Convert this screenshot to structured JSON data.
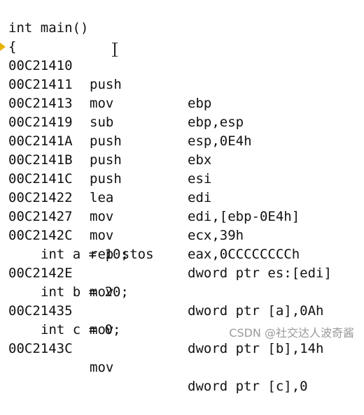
{
  "source": {
    "func_sig": "int main()",
    "open_brace": "{",
    "stmt_a": "int a = 10;",
    "stmt_b": "int b = 20;",
    "stmt_c": "int c = 0;"
  },
  "instructions": [
    {
      "addr": "00C21410",
      "mnem": "push",
      "ops": "ebp"
    },
    {
      "addr": "00C21411",
      "mnem": "mov",
      "ops": "ebp,esp"
    },
    {
      "addr": "00C21413",
      "mnem": "sub",
      "ops": "esp,0E4h"
    },
    {
      "addr": "00C21419",
      "mnem": "push",
      "ops": "ebx"
    },
    {
      "addr": "00C2141A",
      "mnem": "push",
      "ops": "esi"
    },
    {
      "addr": "00C2141B",
      "mnem": "push",
      "ops": "edi"
    },
    {
      "addr": "00C2141C",
      "mnem": "lea",
      "ops": "edi,[ebp-0E4h]"
    },
    {
      "addr": "00C21422",
      "mnem": "mov",
      "ops": "ecx,39h"
    },
    {
      "addr": "00C21427",
      "mnem": "mov",
      "ops": "eax,0CCCCCCCCh"
    },
    {
      "addr": "00C2142C",
      "mnem": "rep stos",
      "ops": "dword ptr es:[edi]"
    },
    {
      "addr": "00C2142E",
      "mnem": "mov",
      "ops": "dword ptr [a],0Ah"
    },
    {
      "addr": "00C21435",
      "mnem": "mov",
      "ops": "dword ptr [b],14h"
    },
    {
      "addr": "00C2143C",
      "mnem": "mov",
      "ops": "dword ptr [c],0"
    }
  ],
  "watermark": "CSDN @社交达人波奇酱",
  "colors": {
    "background": "#ffffff",
    "text": "#111111",
    "breakpoint_marker": "#e8b400"
  },
  "icons": {
    "breakpoint": "current-instruction-arrow-icon",
    "cursor": "text-cursor-icon"
  }
}
